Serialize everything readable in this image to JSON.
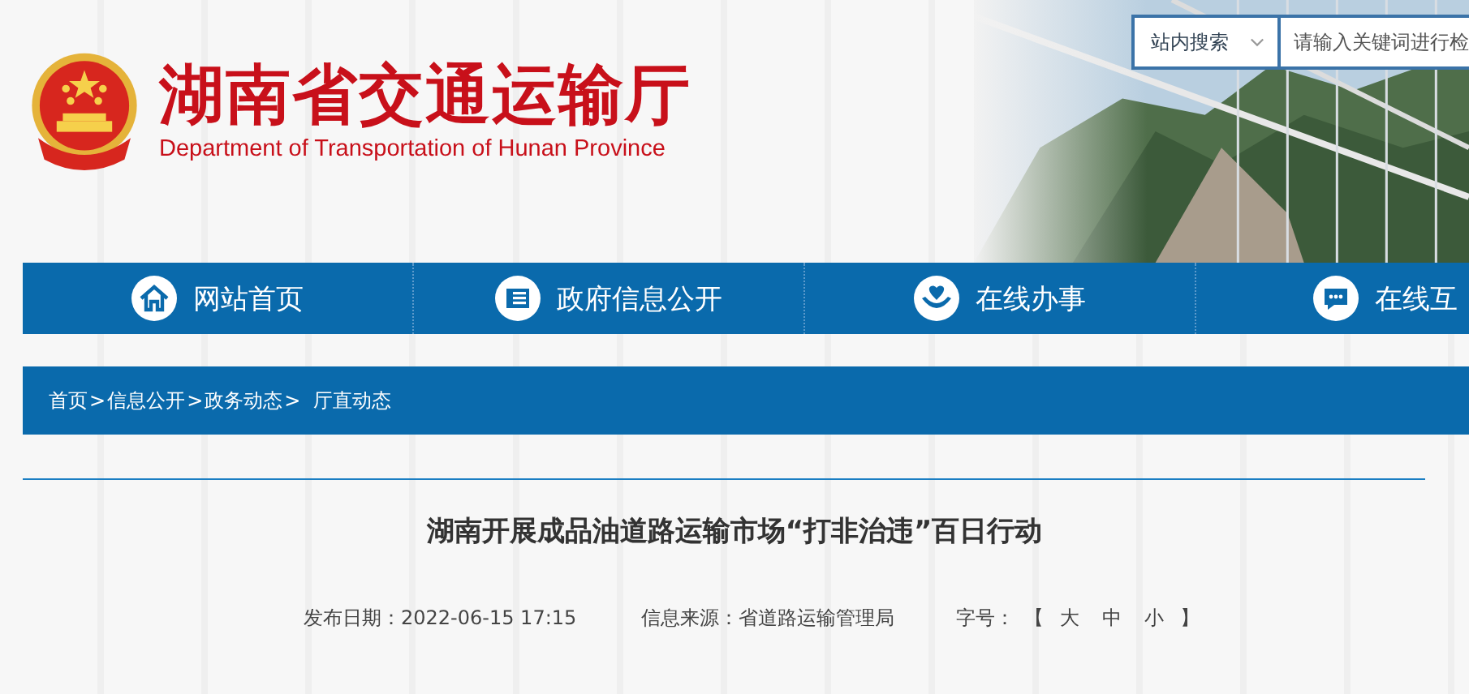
{
  "header": {
    "title": "湖南省交通运输厅",
    "subtitle": "Department of Transportation of Hunan Province",
    "search": {
      "scope": "站内搜索",
      "placeholder": "请输入关键词进行检"
    }
  },
  "nav": [
    {
      "label": "网站首页"
    },
    {
      "label": "政府信息公开"
    },
    {
      "label": "在线办事"
    },
    {
      "label": "在线互"
    }
  ],
  "breadcrumb": [
    {
      "label": "首页",
      "sep": ">"
    },
    {
      "label": "信息公开",
      "sep": ">"
    },
    {
      "label": "政务动态",
      "sep": ">"
    },
    {
      "label": "厅直动态"
    }
  ],
  "article": {
    "title": "湖南开展成品油道路运输市场“打非治违”百日行动",
    "published": "发布日期：2022-06-15 17:15",
    "source": "信息来源：省道路运输管理局",
    "font_size": {
      "label": "字号：",
      "open": "【",
      "options": [
        "大",
        "中",
        "小"
      ],
      "close": "】"
    }
  }
}
